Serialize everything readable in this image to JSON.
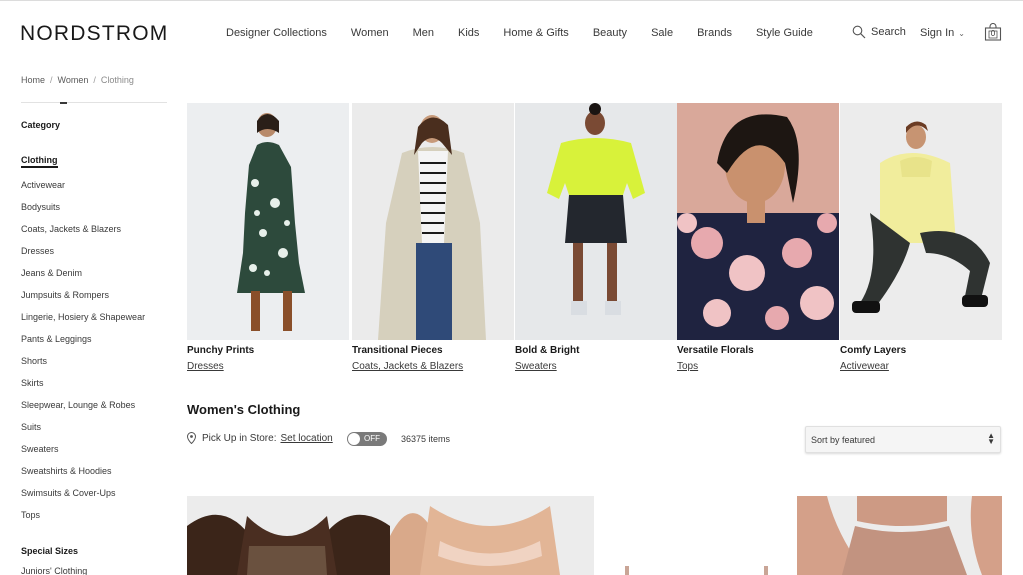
{
  "header": {
    "logo": "NORDSTROM",
    "nav": [
      "Designer Collections",
      "Women",
      "Men",
      "Kids",
      "Home & Gifts",
      "Beauty",
      "Sale",
      "Brands",
      "Style Guide"
    ],
    "search_label": "Search",
    "signin_label": "Sign In",
    "bag_count": "0"
  },
  "breadcrumb": {
    "items": [
      "Home",
      "Women"
    ],
    "current": "Clothing"
  },
  "sidebar": {
    "category_heading": "Category",
    "active": "Clothing",
    "items": [
      "Activewear",
      "Bodysuits",
      "Coats, Jackets & Blazers",
      "Dresses",
      "Jeans & Denim",
      "Jumpsuits & Rompers",
      "Lingerie, Hosiery & Shapewear",
      "Pants & Leggings",
      "Shorts",
      "Skirts",
      "Sleepwear, Lounge & Robes",
      "Suits",
      "Sweaters",
      "Sweatshirts & Hoodies",
      "Swimsuits & Cover-Ups",
      "Tops"
    ],
    "special_sizes_heading": "Special Sizes",
    "juniors": "Juniors' Clothing"
  },
  "tiles": [
    {
      "title": "Punchy Prints",
      "link": "Dresses"
    },
    {
      "title": "Transitional Pieces",
      "link": "Coats, Jackets & Blazers"
    },
    {
      "title": "Bold & Bright",
      "link": "Sweaters"
    },
    {
      "title": "Versatile Florals",
      "link": "Tops"
    },
    {
      "title": "Comfy Layers",
      "link": "Activewear"
    }
  ],
  "results": {
    "title": "Women's Clothing",
    "pickup_label": "Pick Up in Store:",
    "set_location": "Set location",
    "toggle_state": "OFF",
    "item_count": "36375 items",
    "sort_value": "Sort by featured"
  }
}
